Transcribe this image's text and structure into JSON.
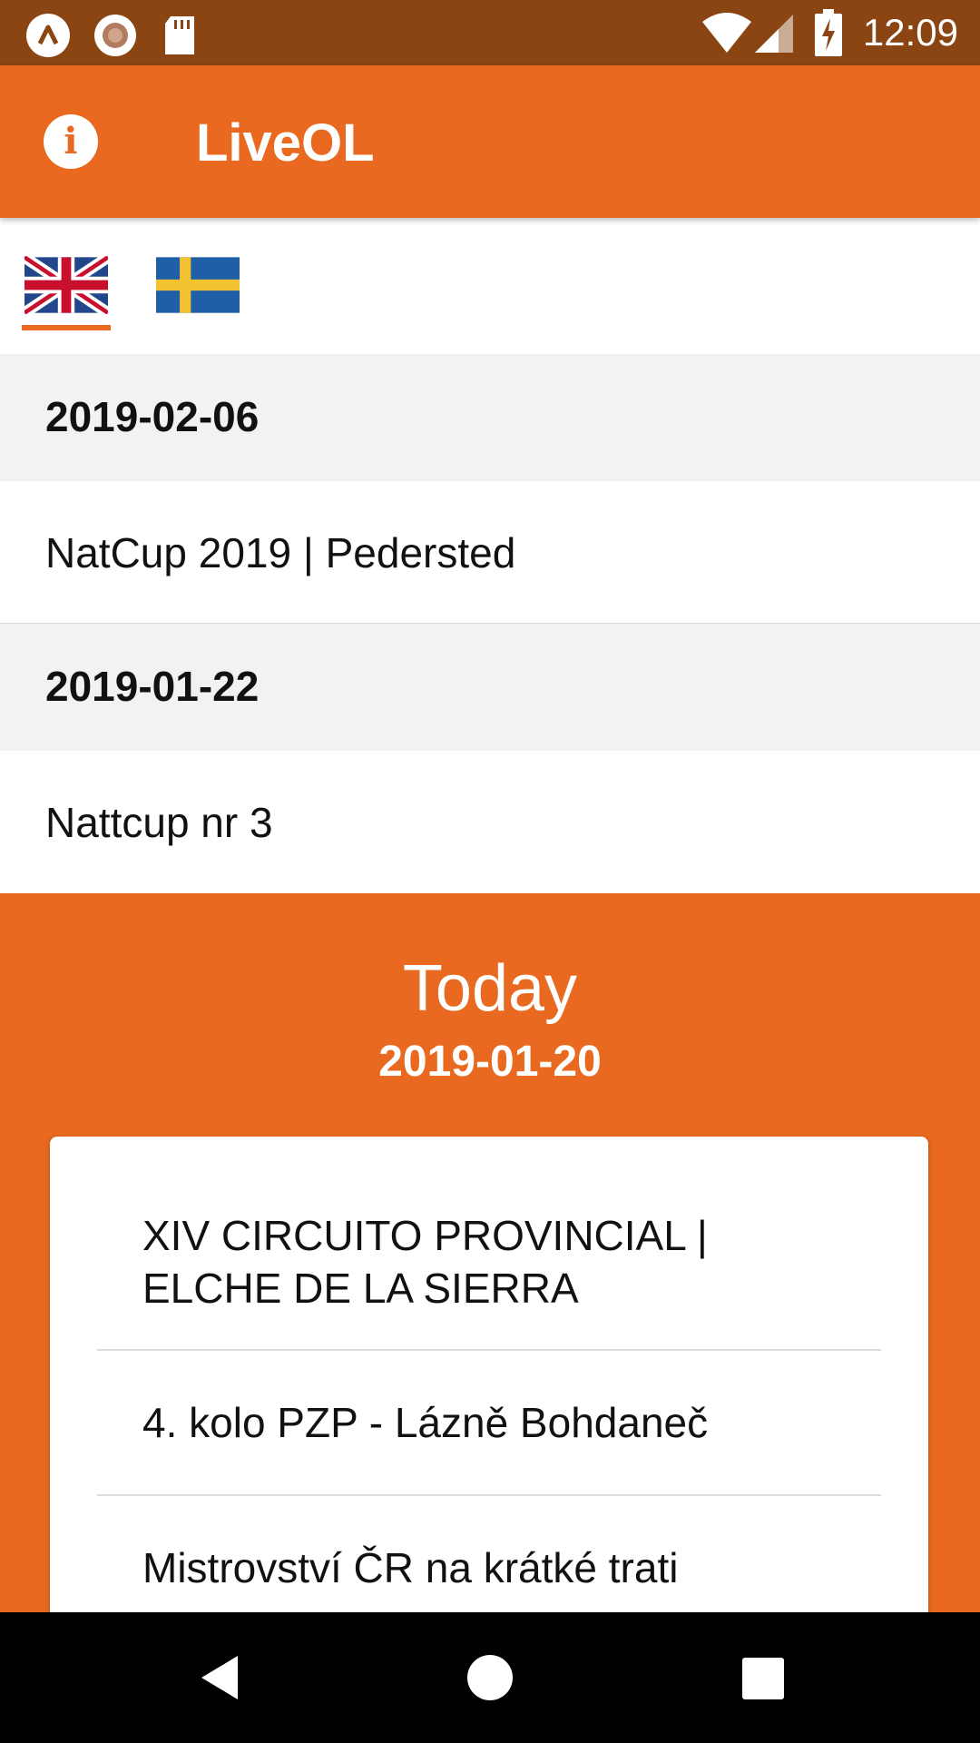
{
  "status_bar": {
    "time": "12:09",
    "left_icons": [
      "app-icon",
      "record-icon",
      "sd-card-icon"
    ],
    "right_icons": [
      "wifi-icon",
      "signal-icon",
      "battery-charging-icon"
    ]
  },
  "app_bar": {
    "title": "LiveOL",
    "info_icon": "info-icon"
  },
  "language_tabs": [
    {
      "icon": "uk-flag-icon",
      "selected": true
    },
    {
      "icon": "sweden-flag-icon",
      "selected": false
    }
  ],
  "competitions": [
    {
      "date": "2019-02-06",
      "events": [
        "NatCup 2019 | Pedersted"
      ]
    },
    {
      "date": "2019-01-22",
      "events": [
        "Nattcup nr 3"
      ]
    }
  ],
  "today": {
    "label": "Today",
    "date": "2019-01-20",
    "events": [
      "XIV CIRCUITO PROVINCIAL |",
      "ELCHE DE LA SIERRA",
      "4. kolo PZP - Lázně Bohdaneč",
      "Mistrovství ČR na krátké trati"
    ]
  },
  "colors": {
    "accent": "#E8691F",
    "status_bar": "#8B4513",
    "header_bg": "#F2F2F2"
  }
}
